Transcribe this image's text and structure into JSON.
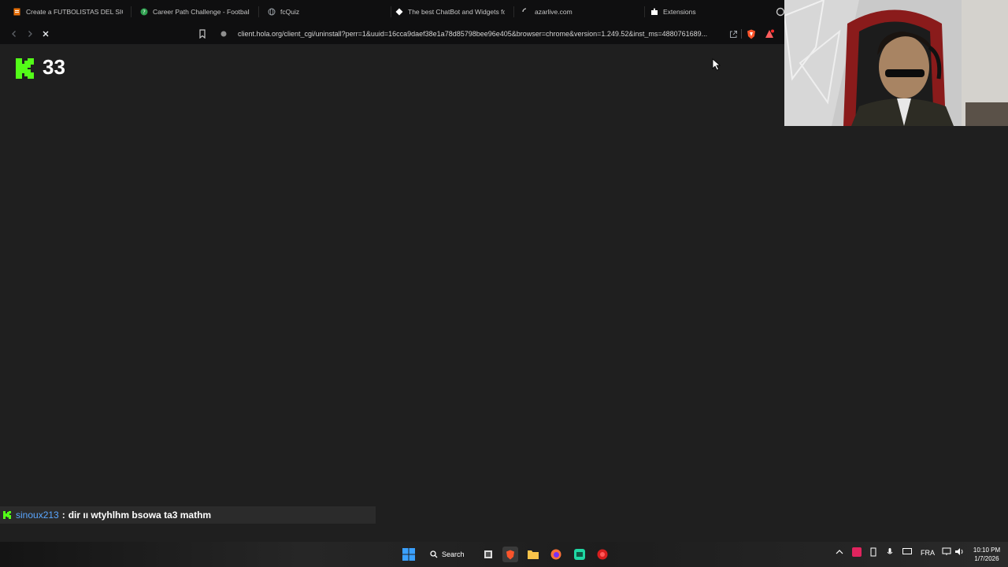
{
  "browser": {
    "tabs": [
      {
        "title": "Create a FUTBOLISTAS DEL SIGLO Ti",
        "icon": "document-icon",
        "color": "#e8710a"
      },
      {
        "title": "Career Path Challenge - Football Wi",
        "icon": "green-circle-icon",
        "color": "#2ea04f"
      },
      {
        "title": "fcQuiz",
        "icon": "globe-icon",
        "color": "#9aa0a6"
      },
      {
        "title": "The best ChatBot and Widgets for K",
        "icon": "diamond-icon",
        "color": "#ffffff"
      },
      {
        "title": "azarlive.com",
        "icon": "loading-icon",
        "color": "#9aa0a6"
      },
      {
        "title": "Extensions",
        "icon": "puzzle-icon",
        "color": "#ffffff"
      }
    ],
    "url": "client.hola.org/client_cgi/uninstall?perr=1&uuid=16cca9daef38e1a78d85798bee96e405&browser=chrome&version=1.249.52&inst_ms=4880761689...",
    "accent": "#53fc18"
  },
  "page": {
    "viewer_count": "33"
  },
  "chat": {
    "username": "sinoux213",
    "separator": ":",
    "message": "dir ıı wtyhlhm bsowa ta3 mathm"
  },
  "taskbar": {
    "search_label": "Search",
    "language": "FRA",
    "time": "10:10 PM",
    "date": "1/7/2026"
  }
}
